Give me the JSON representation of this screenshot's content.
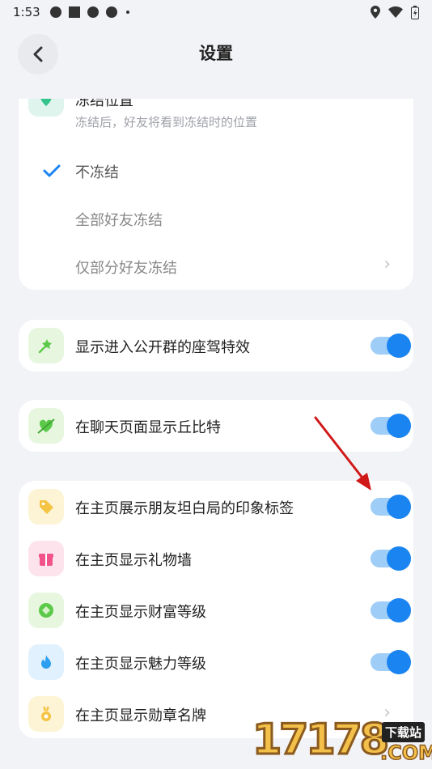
{
  "status_bar": {
    "time": "1:53"
  },
  "nav": {
    "title": "设置"
  },
  "freeze": {
    "title": "冻结位置",
    "description": "冻结后，好友将看到冻结时的位置",
    "options": [
      {
        "label": "不冻结",
        "selected": true
      },
      {
        "label": "全部好友冻结",
        "selected": false
      },
      {
        "label": "仅部分好友冻结",
        "selected": false
      }
    ]
  },
  "settings": {
    "seat_effect": {
      "label": "显示进入公开群的座驾特效",
      "on": true
    },
    "cupid": {
      "label": "在聊天页面显示丘比特",
      "on": true
    },
    "impression_tags": {
      "label": "在主页展示朋友坦白局的印象标签",
      "on": true
    },
    "gift_wall": {
      "label": "在主页显示礼物墙",
      "on": true
    },
    "wealth_level": {
      "label": "在主页显示财富等级",
      "on": true
    },
    "charm_level": {
      "label": "在主页显示魅力等级",
      "on": true
    },
    "medal": {
      "label": "在主页显示勋章名牌"
    }
  },
  "colors": {
    "accent": "#1a84f0",
    "toggle_track": "#9ecdf7",
    "background": "#f2f3f7"
  },
  "watermark": {
    "main": "17178",
    "badge": "下载站",
    "domain": ".COM"
  }
}
